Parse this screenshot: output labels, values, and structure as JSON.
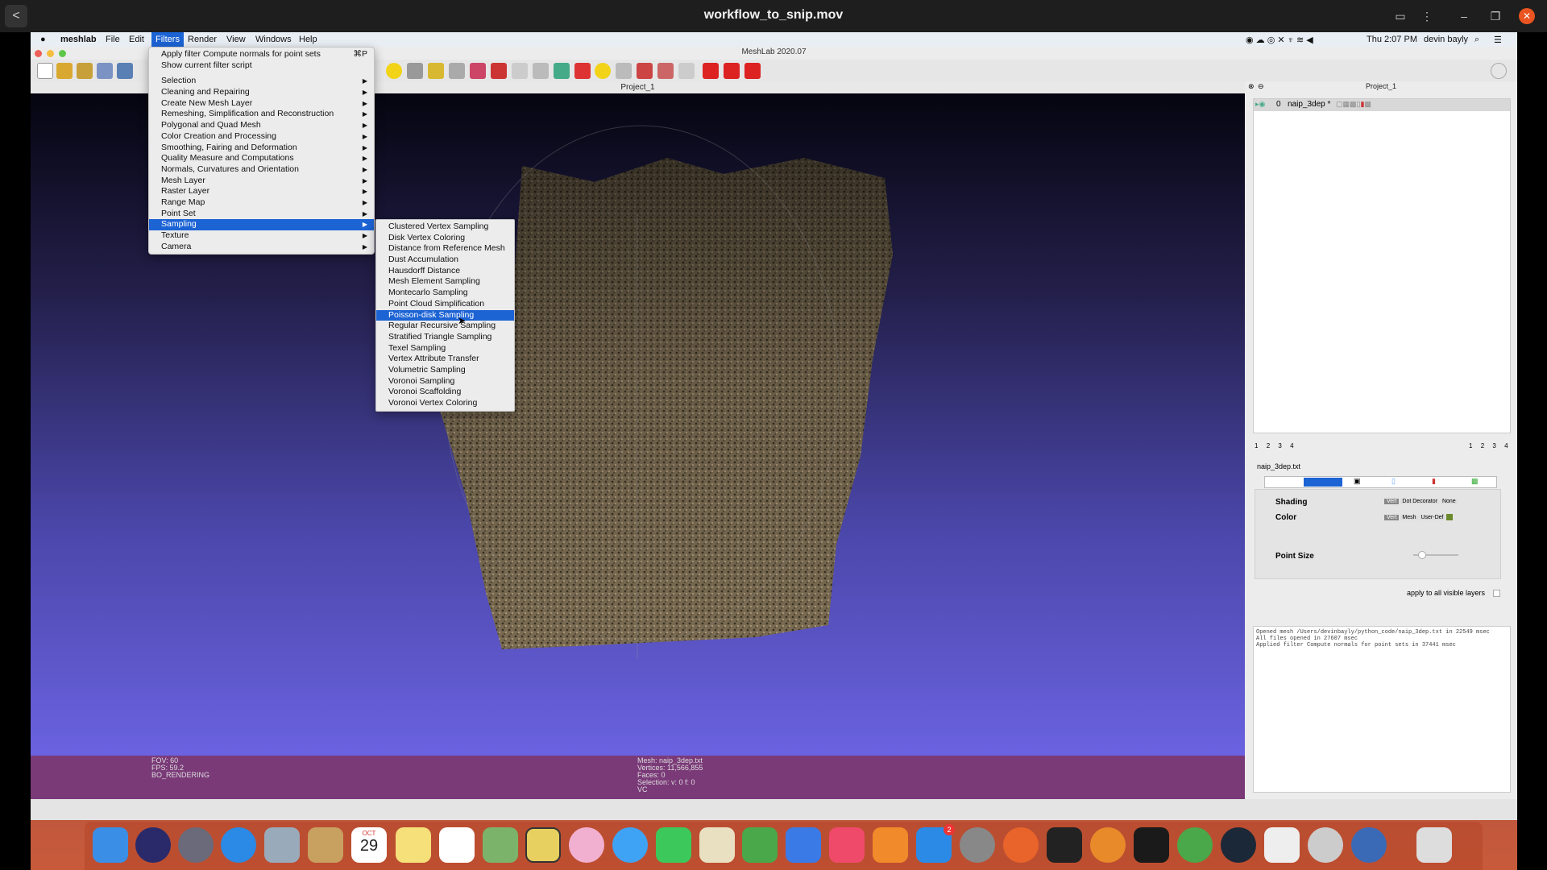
{
  "player": {
    "title": "workflow_to_snip.mov",
    "back": "<"
  },
  "menubar": {
    "app": "meshlab",
    "items": [
      "File",
      "Edit",
      "Filters",
      "Render",
      "View",
      "Windows",
      "Help"
    ],
    "clock": "Thu 2:07 PM",
    "user": "devin bayly"
  },
  "window": {
    "title": "MeshLab 2020.07",
    "viewport_title": "Project_1",
    "panel_title": "Project_1"
  },
  "filters_menu": {
    "apply_last": "Apply filter Compute normals for point sets",
    "apply_shortcut": "⌘P",
    "show_script": "Show current filter script",
    "items": [
      "Selection",
      "Cleaning and Repairing",
      "Create New Mesh Layer",
      "Remeshing, Simplification and Reconstruction",
      "Polygonal and Quad Mesh",
      "Color Creation and Processing",
      "Smoothing, Fairing and Deformation",
      "Quality Measure and Computations",
      "Normals, Curvatures and Orientation",
      "Mesh Layer",
      "Raster Layer",
      "Range Map",
      "Point Set",
      "Sampling",
      "Texture",
      "Camera"
    ],
    "selected": "Sampling"
  },
  "sampling_menu": {
    "items": [
      "Clustered Vertex Sampling",
      "Disk Vertex Coloring",
      "Distance from Reference Mesh",
      "Dust Accumulation",
      "Hausdorff Distance",
      "Mesh Element Sampling",
      "Montecarlo Sampling",
      "Point Cloud Simplification",
      "Poisson-disk Sampling",
      "Regular Recursive Sampling",
      "Stratified Triangle Sampling",
      "Texel Sampling",
      "Vertex Attribute Transfer",
      "Volumetric Sampling",
      "Voronoi Sampling",
      "Voronoi Scaffolding",
      "Voronoi Vertex Coloring"
    ],
    "selected": "Poisson-disk Sampling"
  },
  "layers": {
    "index": "0",
    "name": "naip_3dep *"
  },
  "layer_pages_left": [
    "1",
    "2",
    "3",
    "4"
  ],
  "layer_pages_right": [
    "1",
    "2",
    "3",
    "4"
  ],
  "render_panel": {
    "file": "naip_3dep.txt",
    "shading_label": "Shading",
    "shading_opts": [
      "Vert",
      "Dot Decorator",
      "None"
    ],
    "color_label": "Color",
    "color_opts": [
      "Vert",
      "Mesh",
      "User-Def"
    ],
    "point_size_label": "Point Size",
    "apply_all": "apply to all visible layers",
    "user_color": "#6b8a2e"
  },
  "log": [
    "Opened mesh /Users/devinbayly/python_code/naip_3dep.txt in 22549 msec",
    "All files opened in 27607 msec",
    "Applied filter Compute normals for point sets in 37441 msec"
  ],
  "info": {
    "left": [
      "FOV: 60",
      "FPS:   59.2",
      "BO_RENDERING"
    ],
    "right": [
      "Mesh: naip_3dep.txt",
      "Vertices: 11,566,855",
      "Faces: 0",
      "Selection: v: 0 f: 0",
      "VC"
    ]
  },
  "dock_calendar": {
    "month": "OCT",
    "day": "29"
  },
  "dock_badge": "2"
}
